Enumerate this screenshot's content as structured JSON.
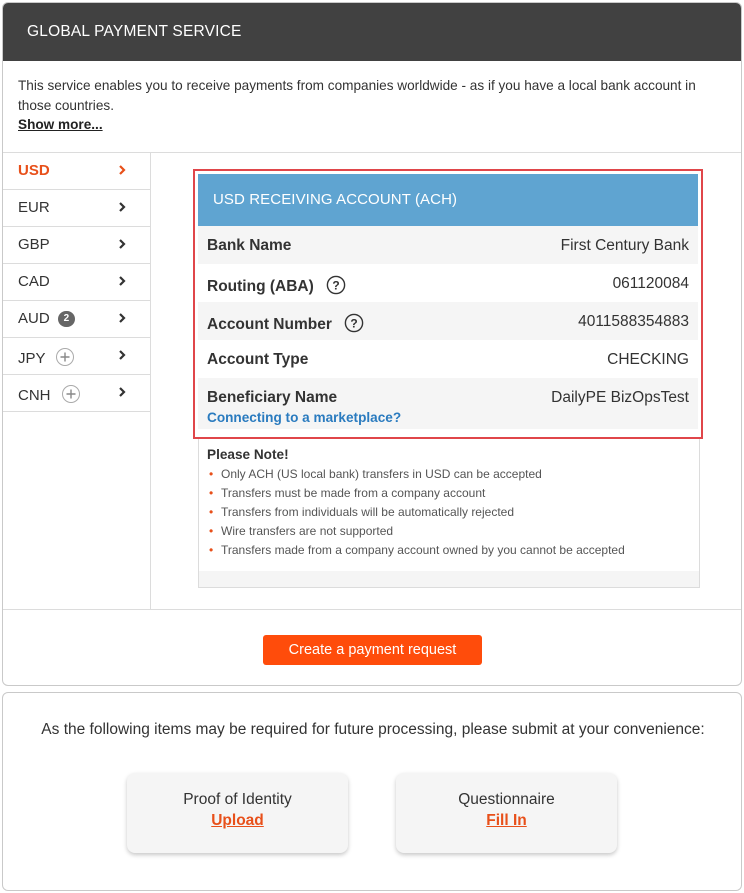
{
  "header": {
    "title": "GLOBAL PAYMENT SERVICE"
  },
  "intro": {
    "text": "This service enables you to receive payments from companies worldwide - as if you have a local bank account in those countries.",
    "show_more": "Show more..."
  },
  "currencies": [
    {
      "code": "USD",
      "active": true
    },
    {
      "code": "EUR"
    },
    {
      "code": "GBP"
    },
    {
      "code": "CAD"
    },
    {
      "code": "AUD",
      "badge": "2"
    },
    {
      "code": "JPY",
      "icon": "plus-circle-icon"
    },
    {
      "code": "CNH",
      "icon": "plus-circle-icon"
    }
  ],
  "account": {
    "title": "USD RECEIVING ACCOUNT (ACH)",
    "rows": [
      {
        "label": "Bank Name",
        "value": "First Century Bank"
      },
      {
        "label": "Routing (ABA)",
        "value": "061120084",
        "help": true
      },
      {
        "label": "Account Number",
        "value": "4011588354883",
        "help": true
      },
      {
        "label": "Account Type",
        "value": "CHECKING"
      },
      {
        "label": "Beneficiary Name",
        "value": "DailyPE BizOpsTest"
      }
    ],
    "marketplace_link": "Connecting to a marketplace?"
  },
  "note": {
    "title": "Please Note!",
    "items": [
      "Only ACH (US local bank) transfers in USD can be accepted",
      "Transfers must be made from a company account",
      "Transfers from individuals will be automatically rejected",
      "Wire transfers are not supported",
      "Transfers made from a company account owned by you cannot be accepted"
    ]
  },
  "cta": {
    "label": "Create a payment request"
  },
  "docs": {
    "text": "As the following items may be required for future processing, please submit at your convenience:",
    "cards": [
      {
        "title": "Proof of Identity",
        "action": "Upload"
      },
      {
        "title": "Questionnaire",
        "action": "Fill In"
      }
    ]
  },
  "colors": {
    "accent": "#e8501a",
    "cta": "#ff4c0b",
    "account_header": "#5fa4d1",
    "header_bg": "#414141",
    "highlight_border": "#e0464a",
    "link": "#2a7bbf"
  }
}
